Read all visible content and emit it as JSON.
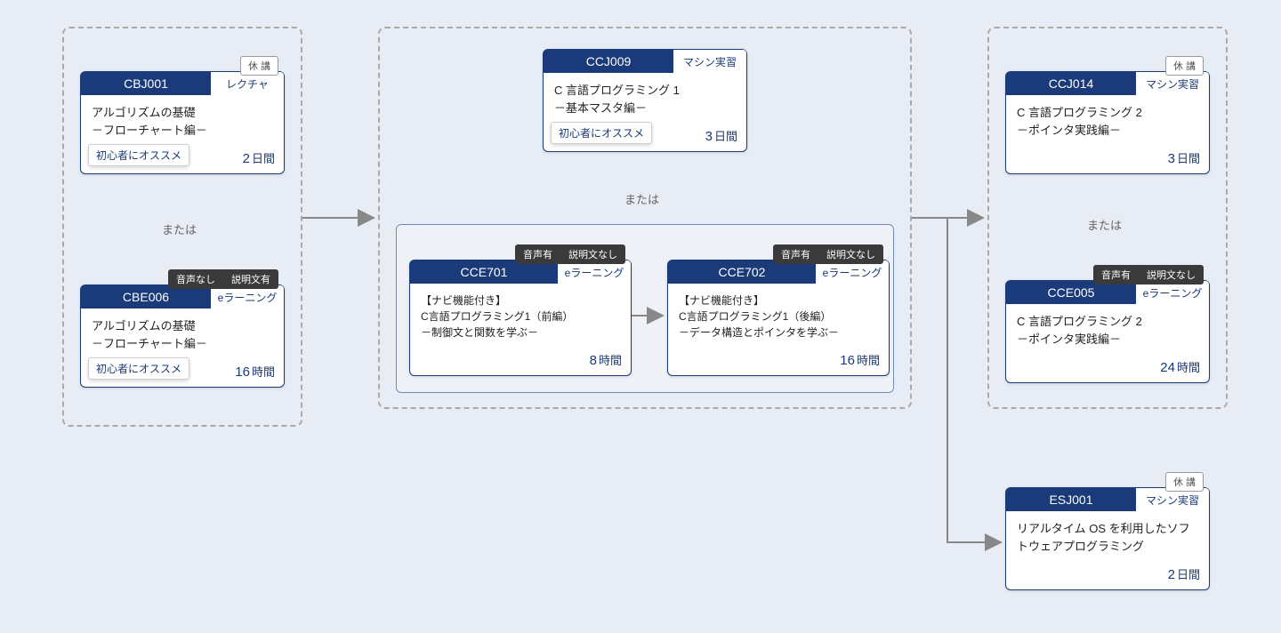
{
  "labels": {
    "or": "または",
    "suspended": "休 講",
    "recommended": "初心者にオススメ",
    "audio_yes": "音声有",
    "audio_no": "音声なし",
    "desc_yes": "説明文有",
    "desc_no": "説明文なし"
  },
  "types": {
    "lecture": "レクチャ",
    "elearning": "eラーニング",
    "machine": "マシン実習"
  },
  "units": {
    "days": "日間",
    "hours": "時間"
  },
  "cards": {
    "cbj001": {
      "code": "CBJ001",
      "type": "レクチャ",
      "title": "アルゴリズムの基礎\n－フローチャート編－",
      "num": "2",
      "unit": "日間"
    },
    "cbe006": {
      "code": "CBE006",
      "type": "eラーニング",
      "title": "アルゴリズムの基礎\n－フローチャート編－",
      "num": "16",
      "unit": "時間"
    },
    "ccj009": {
      "code": "CCJ009",
      "type": "マシン実習",
      "title": "C 言語プログラミング 1\n－基本マスタ編－",
      "num": "3",
      "unit": "日間"
    },
    "cce701": {
      "code": "CCE701",
      "type": "eラーニング",
      "title": "【ナビ機能付き】\nC言語プログラミング1（前編）\n－制御文と関数を学ぶ－",
      "num": "8",
      "unit": "時間"
    },
    "cce702": {
      "code": "CCE702",
      "type": "eラーニング",
      "title": "【ナビ機能付き】\nC言語プログラミング1（後編）\n－データ構造とポインタを学ぶ－",
      "num": "16",
      "unit": "時間"
    },
    "ccj014": {
      "code": "CCJ014",
      "type": "マシン実習",
      "title": "C 言語プログラミング 2\n－ポインタ実践編－",
      "num": "3",
      "unit": "日間"
    },
    "cce005": {
      "code": "CCE005",
      "type": "eラーニング",
      "title": "C 言語プログラミング 2\n－ポインタ実践編－",
      "num": "24",
      "unit": "時間"
    },
    "esj001": {
      "code": "ESJ001",
      "type": "マシン実習",
      "title": "リアルタイム OS を利用したソフトウェアプログラミング",
      "num": "2",
      "unit": "日間"
    }
  }
}
